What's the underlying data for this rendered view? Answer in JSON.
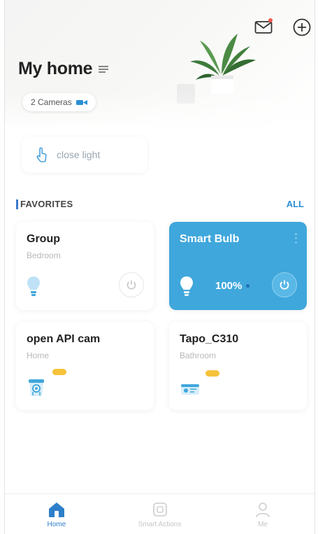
{
  "header": {
    "title": "My home",
    "cameras_label": "2 Cameras",
    "icons": [
      "mail-icon",
      "add-circle-icon",
      "menu-icon"
    ]
  },
  "shortcut": {
    "label": "close light"
  },
  "favorites": {
    "title": "FAVORITES",
    "all_label": "ALL",
    "devices": [
      {
        "name": "Group",
        "room": "Bedroom",
        "icon": "bulb-icon",
        "state": "off"
      },
      {
        "name": "Smart Bulb",
        "room": "",
        "icon": "bulb-icon",
        "state": "on",
        "brightness": "100%"
      },
      {
        "name": "open API cam",
        "room": "Home",
        "icon": "camera-icon"
      },
      {
        "name": "Tapo_C310",
        "room": "Bathroom",
        "icon": "outdoor-camera-icon"
      }
    ]
  },
  "tabbar": {
    "tabs": [
      {
        "label": "Home",
        "icon": "home-icon",
        "active": true
      },
      {
        "label": "Smart Actions",
        "icon": "smart-actions-icon",
        "active": false
      },
      {
        "label": "Me",
        "icon": "person-icon",
        "active": false
      }
    ]
  },
  "colors": {
    "accent": "#3fa7dc",
    "link": "#2a8fd6",
    "active_tab": "#2c7fc9",
    "badge": "#f6c23b"
  }
}
